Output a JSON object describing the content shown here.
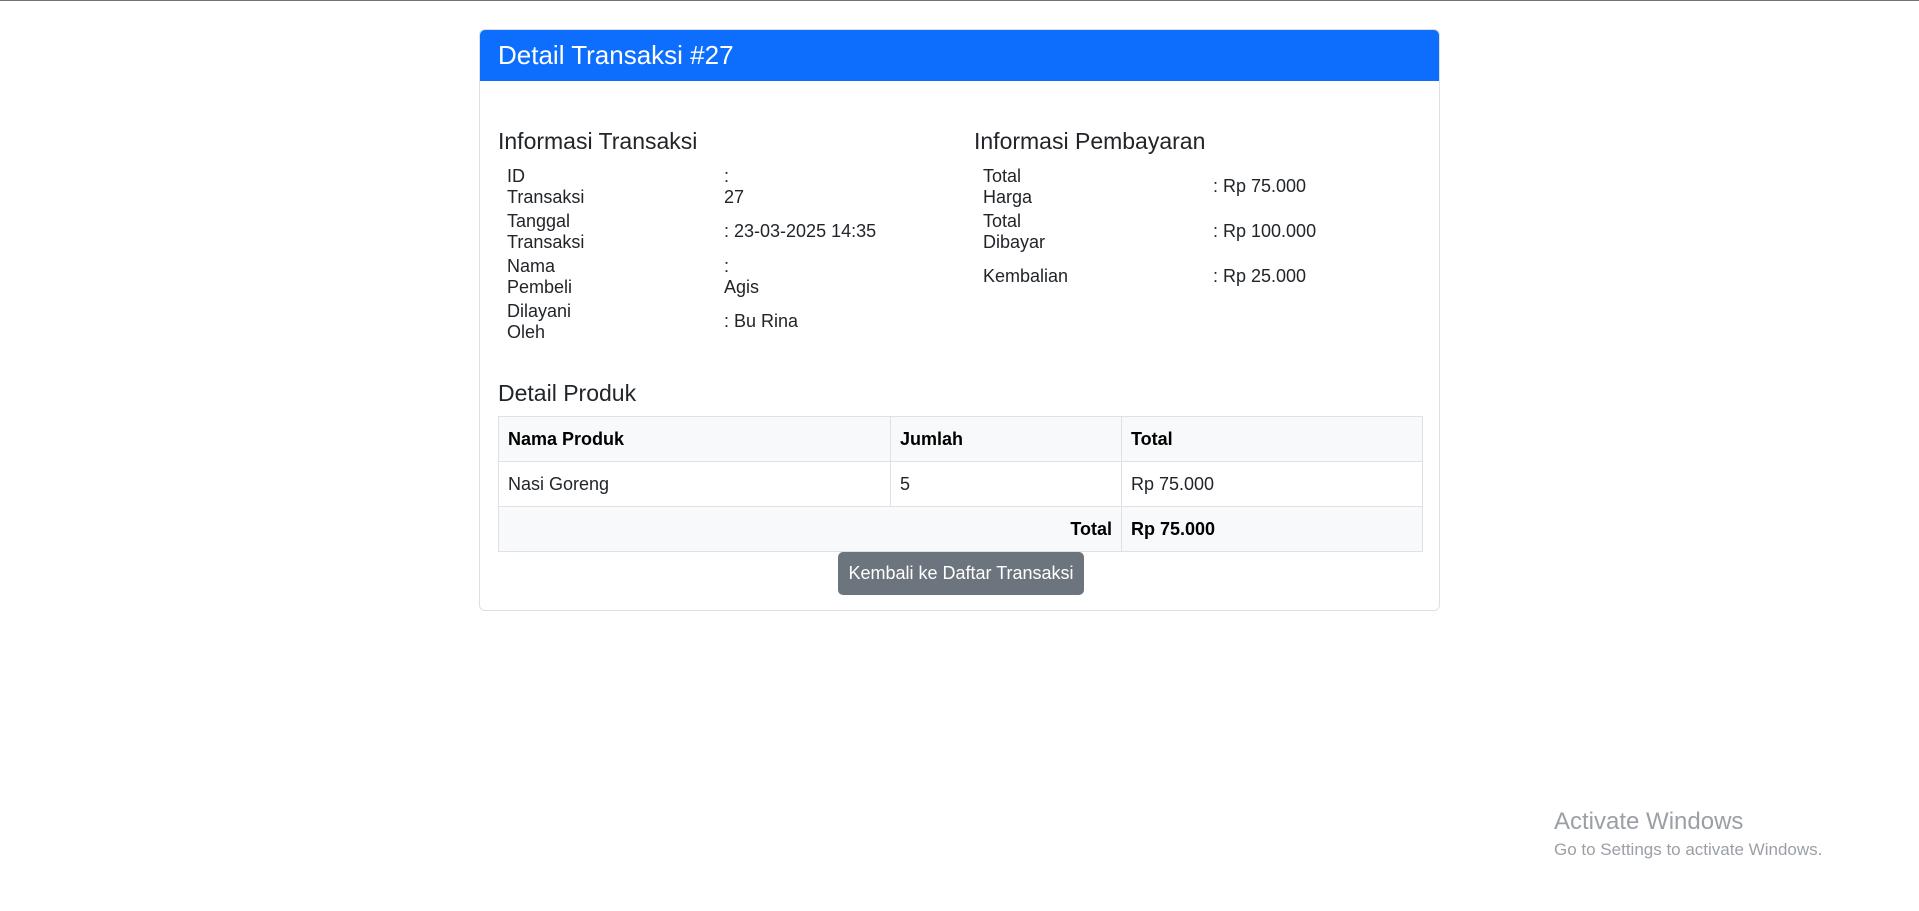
{
  "header": {
    "title": "Detail Transaksi #27"
  },
  "transaction_info": {
    "title": "Informasi Transaksi",
    "rows": [
      {
        "label": "ID Transaksi",
        "value": ": 27"
      },
      {
        "label": "Tanggal Transaksi",
        "value": ": 23-03-2025 14:35"
      },
      {
        "label": "Nama Pembeli",
        "value": ": Agis"
      },
      {
        "label": "Dilayani Oleh",
        "value": ": Bu Rina"
      }
    ]
  },
  "payment_info": {
    "title": "Informasi Pembayaran",
    "rows": [
      {
        "label": "Total Harga",
        "value": ": Rp 75.000"
      },
      {
        "label": "Total Dibayar",
        "value": ": Rp 100.000"
      },
      {
        "label": "Kembalian",
        "value": ": Rp 25.000"
      }
    ]
  },
  "products": {
    "title": "Detail Produk",
    "columns": [
      "Nama Produk",
      "Jumlah",
      "Total"
    ],
    "rows": [
      {
        "name": "Nasi Goreng",
        "qty": "5",
        "total": "Rp 75.000"
      }
    ],
    "footer_label": "Total",
    "footer_value": "Rp 75.000"
  },
  "actions": {
    "back_label": "Kembali ke Daftar Transaksi"
  },
  "watermark": {
    "title": "Activate Windows",
    "subtitle": "Go to Settings to activate Windows."
  },
  "colors": {
    "primary": "#0d6efd",
    "secondary": "#6c757d"
  }
}
